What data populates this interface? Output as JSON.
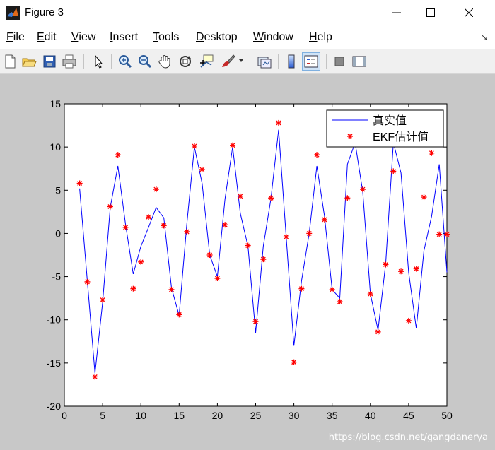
{
  "window": {
    "title": "Figure 3"
  },
  "menu": [
    {
      "mnemonic": "F",
      "rest": "ile"
    },
    {
      "mnemonic": "E",
      "rest": "dit"
    },
    {
      "mnemonic": "V",
      "rest": "iew"
    },
    {
      "mnemonic": "I",
      "rest": "nsert"
    },
    {
      "mnemonic": "T",
      "rest": "ools"
    },
    {
      "mnemonic": "D",
      "rest": "esktop"
    },
    {
      "mnemonic": "W",
      "rest": "indow"
    },
    {
      "mnemonic": "H",
      "rest": "elp"
    }
  ],
  "dock_arrow": "↘",
  "toolbar_icons": [
    "new-figure-icon",
    "open-file-icon",
    "save-icon",
    "print-icon",
    "pointer-icon",
    "zoom-in-icon",
    "zoom-out-icon",
    "pan-icon",
    "rotate-3d-icon",
    "data-cursor-icon",
    "brush-icon",
    "link-plot-icon",
    "colorbar-icon",
    "legend-icon",
    "hide-plot-tools-icon",
    "show-plot-tools-icon"
  ],
  "watermark": "https://blog.csdn.net/gangdanerya",
  "colors": {
    "figure_bg": "#c8c8c8",
    "true_line": "#0000ff",
    "ekf_marker": "#ff0000"
  },
  "chart_data": {
    "type": "line",
    "title": "",
    "xlabel": "",
    "ylabel": "",
    "xlim": [
      0,
      50
    ],
    "ylim": [
      -20,
      15
    ],
    "xticks": [
      0,
      5,
      10,
      15,
      20,
      25,
      30,
      35,
      40,
      45,
      50
    ],
    "yticks": [
      -20,
      -15,
      -10,
      -5,
      0,
      5,
      10,
      15
    ],
    "grid": false,
    "legend_position": "top-right",
    "x": [
      2,
      3,
      4,
      5,
      6,
      7,
      8,
      9,
      10,
      11,
      12,
      13,
      14,
      15,
      16,
      17,
      18,
      19,
      20,
      21,
      22,
      23,
      24,
      25,
      26,
      27,
      28,
      29,
      30,
      31,
      32,
      33,
      34,
      35,
      36,
      37,
      38,
      39,
      40,
      41,
      42,
      43,
      44,
      45,
      46,
      47,
      48,
      49,
      50
    ],
    "series": [
      {
        "name": "真实值",
        "style": "line",
        "values": [
          5.2,
          -5.5,
          -16.2,
          -8,
          3,
          7.8,
          1,
          -4.7,
          -1.5,
          0.7,
          3,
          1.8,
          -6.3,
          -9.5,
          1,
          10,
          5.8,
          -2.5,
          -5,
          4,
          10,
          2.3,
          -1.5,
          -11.5,
          -1.5,
          4,
          12,
          -0.5,
          -13,
          -5.5,
          0,
          7.8,
          2,
          -6.5,
          -7.5,
          8,
          10.5,
          4.8,
          -7,
          -11.2,
          -3.5,
          10.5,
          7,
          -4.5,
          -11,
          -2,
          2,
          8,
          -4.5
        ]
      },
      {
        "name": "EKF估计值",
        "style": "marker",
        "values": [
          5.8,
          -5.6,
          -16.6,
          -7.7,
          3.1,
          9.1,
          0.7,
          -6.4,
          -3.3,
          1.9,
          5.1,
          0.9,
          -6.5,
          -9.4,
          0.2,
          10.1,
          7.4,
          -2.5,
          -5.2,
          1,
          10.2,
          4.3,
          -1.4,
          -10.2,
          -3,
          4.1,
          12.8,
          -0.4,
          -14.9,
          -6.4,
          0,
          9.1,
          1.6,
          -6.5,
          -7.9,
          4.1,
          11.1,
          5.1,
          -7,
          -11.4,
          -3.6,
          7.2,
          -4.4,
          -10.1,
          -4.1,
          4.2,
          9.3,
          -0.1,
          -0.1
        ]
      }
    ]
  }
}
